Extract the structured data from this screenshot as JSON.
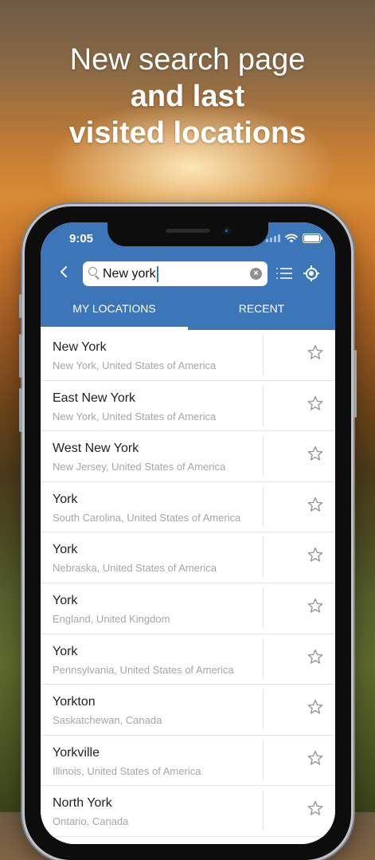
{
  "promo": {
    "line1": "New search page",
    "line2": "and last",
    "line3": "visited locations"
  },
  "status_bar": {
    "time": "9:05"
  },
  "search": {
    "value": "New york",
    "placeholder": ""
  },
  "tabs": [
    {
      "label": "MY LOCATIONS",
      "selected": true
    },
    {
      "label": "RECENT",
      "selected": false
    }
  ],
  "results": [
    {
      "name": "New York",
      "detail": "New York, United States of America"
    },
    {
      "name": "East New York",
      "detail": "New York, United States of America"
    },
    {
      "name": "West New York",
      "detail": "New Jersey, United States of America"
    },
    {
      "name": "York",
      "detail": "South Carolina, United States of America"
    },
    {
      "name": "York",
      "detail": "Nebraska, United States of America"
    },
    {
      "name": "York",
      "detail": "England, United Kingdom"
    },
    {
      "name": "York",
      "detail": "Pennsylvania, United States of America"
    },
    {
      "name": "Yorkton",
      "detail": "Saskatchewan, Canada"
    },
    {
      "name": "Yorkville",
      "detail": "Illinois, United States of America"
    },
    {
      "name": "North York",
      "detail": "Ontario, Canada"
    }
  ],
  "icons": {
    "back": "chevron-left-icon",
    "search": "search-icon",
    "clear": "clear-icon",
    "list": "list-icon",
    "location": "location-target-icon",
    "favorite": "star-icon"
  },
  "colors": {
    "header": "#3d76b8",
    "text": "#222222",
    "muted": "#a6a6a6",
    "star": "#9a9a9a"
  }
}
